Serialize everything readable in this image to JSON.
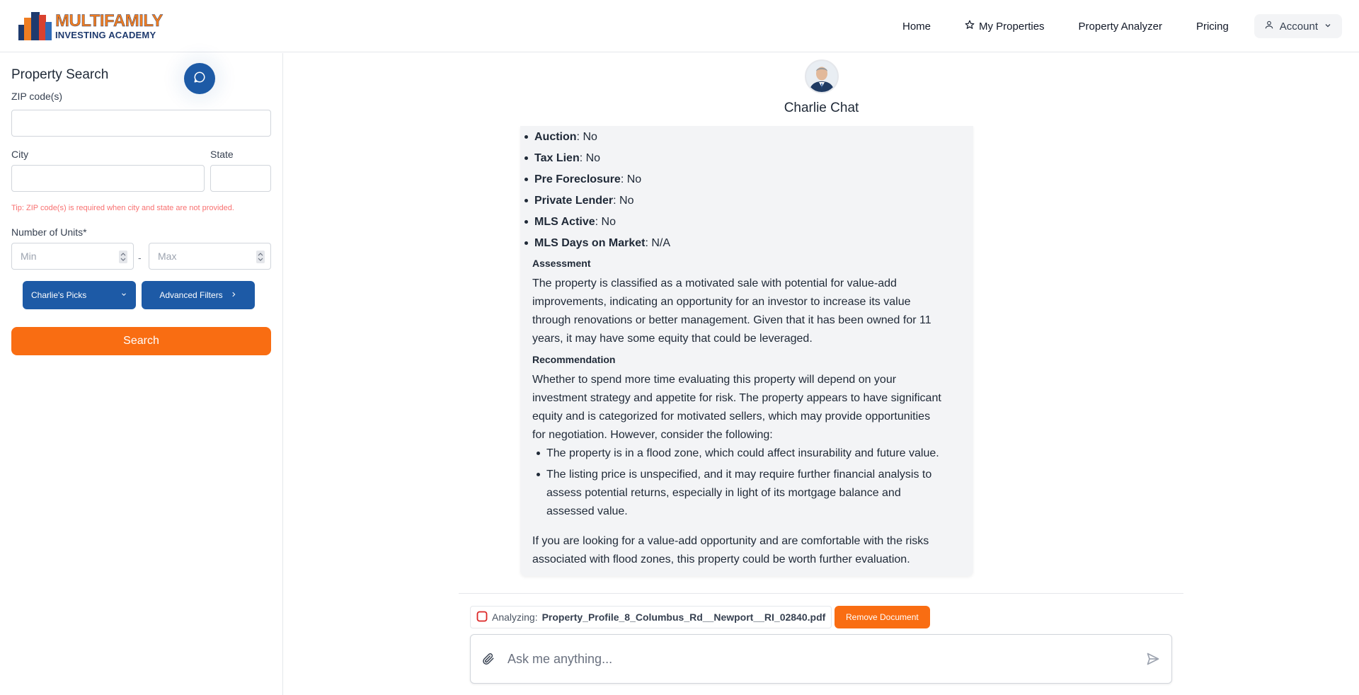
{
  "header": {
    "logo": {
      "line1": "MULTIFAMILY",
      "line2": "INVESTING ACADEMY"
    },
    "nav": {
      "home": "Home",
      "my_properties": "My Properties",
      "property_analyzer": "Property Analyzer",
      "pricing": "Pricing",
      "account": "Account"
    }
  },
  "sidebar": {
    "title": "Property Search",
    "zip_label": "ZIP code(s)",
    "zip_value": "",
    "city_label": "City",
    "city_value": "",
    "state_label": "State",
    "state_value": "",
    "tip": "Tip: ZIP code(s) is required when city and state are not provided.",
    "units_label": "Number of Units*",
    "units_min_placeholder": "Min",
    "units_max_placeholder": "Max",
    "units_separator": "-",
    "charlies_picks": "Charlie's Picks",
    "advanced_filters": "Advanced Filters",
    "search_button": "Search"
  },
  "chat": {
    "name": "Charlie Chat",
    "message": {
      "facts": [
        {
          "label": "Auction",
          "value": ": No"
        },
        {
          "label": "Tax Lien",
          "value": ": No"
        },
        {
          "label": "Pre Foreclosure",
          "value": ": No"
        },
        {
          "label": "Private Lender",
          "value": ": No"
        },
        {
          "label": "MLS Active",
          "value": ": No"
        },
        {
          "label": "MLS Days on Market",
          "value": ": N/A"
        }
      ],
      "assessment_heading": "Assessment",
      "assessment_lines": [
        "The property is classified as a motivated sale with potential for value-add",
        "improvements, indicating an opportunity for an investor to increase its value",
        "through renovations or better management. Given that it has been owned for 11",
        "years, it may have some equity that could be leveraged."
      ],
      "recommendation_heading": "Recommendation",
      "recommendation_lines": [
        "Whether to spend more time evaluating this property will depend on your",
        "investment strategy and appetite for risk. The property appears to have significant",
        "equity and is categorized for motivated sellers, which may provide opportunities",
        "for negotiation. However, consider the following:"
      ],
      "considerations": [
        [
          "The property is in a flood zone, which could affect insurability and future value."
        ],
        [
          "The listing price is unspecified, and it may require further financial analysis to",
          "assess potential returns, especially in light of its mortgage balance and",
          "assessed value."
        ]
      ],
      "closing_lines": [
        "If you are looking for a value-add opportunity and are comfortable with the risks",
        "associated with flood zones, this property could be worth further evaluation."
      ]
    },
    "document": {
      "prefix": "Analyzing:",
      "filename": "Property_Profile_8_Columbus_Rd__Newport__RI_02840.pdf",
      "remove_label": "Remove Document"
    },
    "input_placeholder": "Ask me anything..."
  },
  "colors": {
    "brand_orange": "#f96d12",
    "brand_blue": "#1d5aa6",
    "tip_red": "#f87171"
  }
}
